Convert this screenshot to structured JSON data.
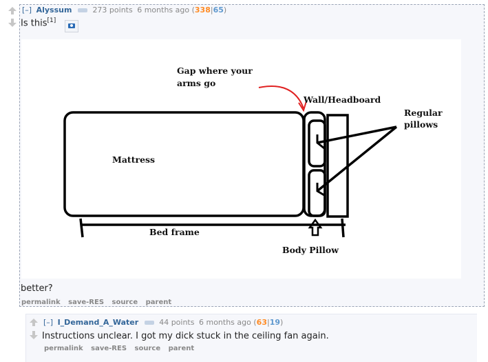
{
  "comment1": {
    "toggle": "[–]",
    "author": "Alyssum",
    "score": "273 points",
    "time": "6 months ago",
    "ups": "338",
    "downs": "65",
    "body_text": "Is this",
    "footnote": "[1]",
    "after_text": "better?",
    "actions": [
      "permalink",
      "save-RES",
      "source",
      "parent"
    ],
    "image": {
      "labels": {
        "gap": [
          "Gap where your",
          "arms go"
        ],
        "wall": "Wall/Headboard",
        "regular": [
          "Regular",
          "pillows"
        ],
        "mattress": "Mattress",
        "bed_frame": "Bed frame",
        "body_pillow": "Body Pillow"
      }
    }
  },
  "comment2": {
    "toggle": "[–]",
    "author": "I_Demand_A_Water",
    "score": "44 points",
    "time": "6 months ago",
    "ups": "63",
    "downs": "19",
    "body_text": "Instructions unclear. I got my dick stuck in the ceiling fan again.",
    "actions": [
      "permalink",
      "save-RES",
      "source",
      "parent"
    ]
  },
  "colors": {
    "author": "#336699",
    "upvotes": "#ff8b24",
    "downvotes": "#5f99cf",
    "arrow": "#e02020"
  }
}
